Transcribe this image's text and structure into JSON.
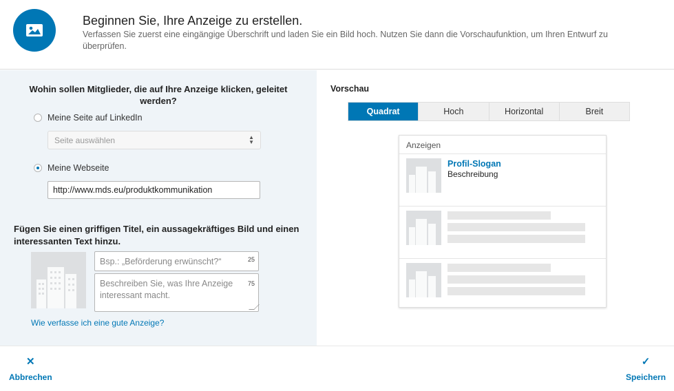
{
  "header": {
    "title": "Beginnen Sie, Ihre Anzeige zu erstellen.",
    "subtitle": "Verfassen Sie zuerst eine eingängige Überschrift und laden Sie ein Bild hoch. Nutzen Sie dann die Vorschaufunktion, um Ihren Entwurf zu überprüfen.",
    "icon": "image-icon",
    "accent": "#0077b5"
  },
  "destination": {
    "question": "Wohin sollen Mitglieder, die auf Ihre Anzeige klicken, geleitet werden?",
    "option_linkedin": "Meine Seite auf LinkedIn",
    "select_placeholder": "Seite auswählen",
    "option_website": "Meine Webseite",
    "selected": "Meine Webseite",
    "url_value": "http://www.mds.eu/produktkommunikation"
  },
  "content": {
    "question": "Fügen Sie einen griffigen Titel, ein aussagekräftiges Bild und einen interessanten Text hinzu.",
    "title_placeholder": "Bsp.: „Beförderung erwünscht?“",
    "title_counter": "25",
    "desc_placeholder": "Beschreiben Sie, was Ihre Anzeige interessant macht.",
    "desc_counter": "75",
    "help_link": "Wie verfasse ich eine gute Anzeige?"
  },
  "preview": {
    "label": "Vorschau",
    "tabs": [
      "Quadrat",
      "Hoch",
      "Horizontal",
      "Breit"
    ],
    "active_tab": "Quadrat",
    "card_header": "Anzeigen",
    "ad_title": "Profil-Slogan",
    "ad_desc": "Beschreibung"
  },
  "footer": {
    "cancel": "Abbrechen",
    "save": "Speichern"
  }
}
